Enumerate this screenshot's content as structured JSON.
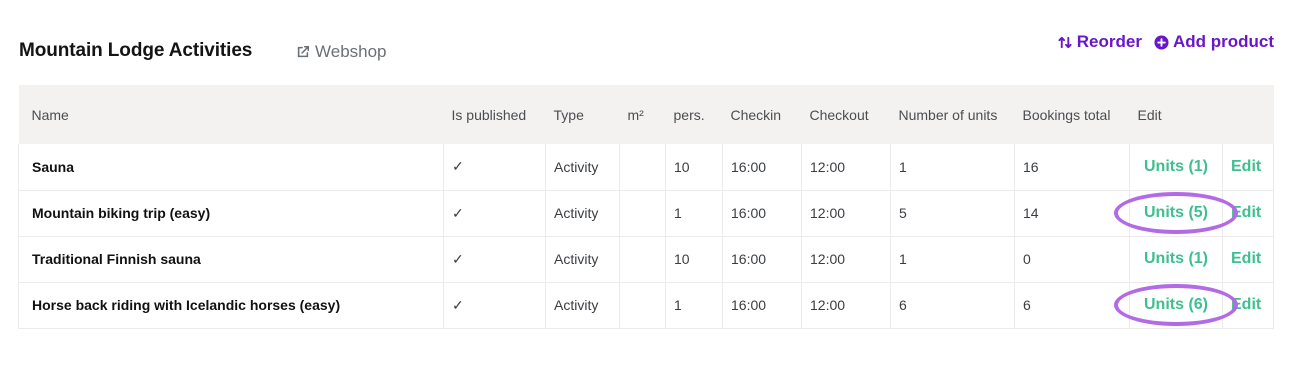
{
  "header": {
    "title": "Mountain Lodge Activities",
    "webshop_label": "Webshop",
    "reorder_label": "Reorder",
    "add_product_label": "Add product"
  },
  "colors": {
    "accent": "#6a16c9",
    "link_green": "#3fbf8f",
    "highlight": "#b36ae6"
  },
  "table": {
    "headers": {
      "name": "Name",
      "published": "Is published",
      "type": "Type",
      "m2": "m²",
      "pers": "pers.",
      "checkin": "Checkin",
      "checkout": "Checkout",
      "units": "Number of units",
      "bookings": "Bookings total",
      "edit": "Edit"
    },
    "rows": [
      {
        "name": "Sauna",
        "published": "✓",
        "type": "Activity",
        "m2": "",
        "pers": "10",
        "checkin": "16:00",
        "checkout": "12:00",
        "units": "1",
        "bookings": "16",
        "units_link": "Units (1)",
        "edit_link": "Edit"
      },
      {
        "name": "Mountain biking trip (easy)",
        "published": "✓",
        "type": "Activity",
        "m2": "",
        "pers": "1",
        "checkin": "16:00",
        "checkout": "12:00",
        "units": "5",
        "bookings": "14",
        "units_link": "Units (5)",
        "edit_link": "Edit"
      },
      {
        "name": "Traditional Finnish sauna",
        "published": "✓",
        "type": "Activity",
        "m2": "",
        "pers": "10",
        "checkin": "16:00",
        "checkout": "12:00",
        "units": "1",
        "bookings": "0",
        "units_link": "Units (1)",
        "edit_link": "Edit"
      },
      {
        "name": "Horse back riding with Icelandic horses (easy)",
        "published": "✓",
        "type": "Activity",
        "m2": "",
        "pers": "1",
        "checkin": "16:00",
        "checkout": "12:00",
        "units": "6",
        "bookings": "6",
        "units_link": "Units (6)",
        "edit_link": "Edit"
      }
    ]
  }
}
